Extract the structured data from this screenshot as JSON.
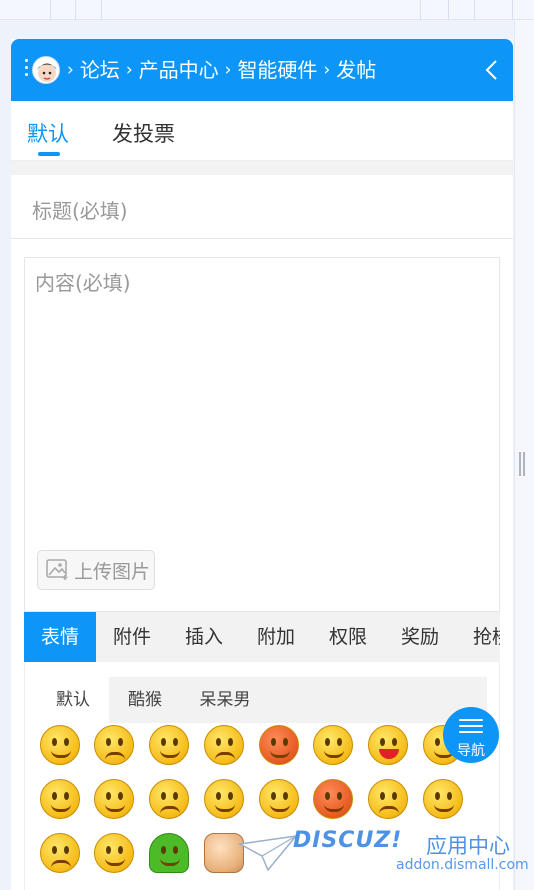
{
  "header": {
    "breadcrumb": [
      "论坛",
      "产品中心",
      "智能硬件",
      "发帖"
    ],
    "separator": "›",
    "bg_color": "#0d96f8"
  },
  "tabs": [
    {
      "label": "默认",
      "active": true
    },
    {
      "label": "发投票",
      "active": false
    }
  ],
  "form": {
    "title_placeholder": "标题(必填)",
    "content_placeholder": "内容(必填)",
    "upload_label": "上传图片"
  },
  "panel_tabs": [
    "表情",
    "附件",
    "插入",
    "附加",
    "权限",
    "奖励",
    "抢楼"
  ],
  "emoji_tabs": [
    "默认",
    "酷猴",
    "呆呆男"
  ],
  "nav_button": {
    "label": "导航"
  },
  "watermark": {
    "brand": "DISCUZ!",
    "name": "应用中心",
    "url": "addon.dismall.com"
  }
}
